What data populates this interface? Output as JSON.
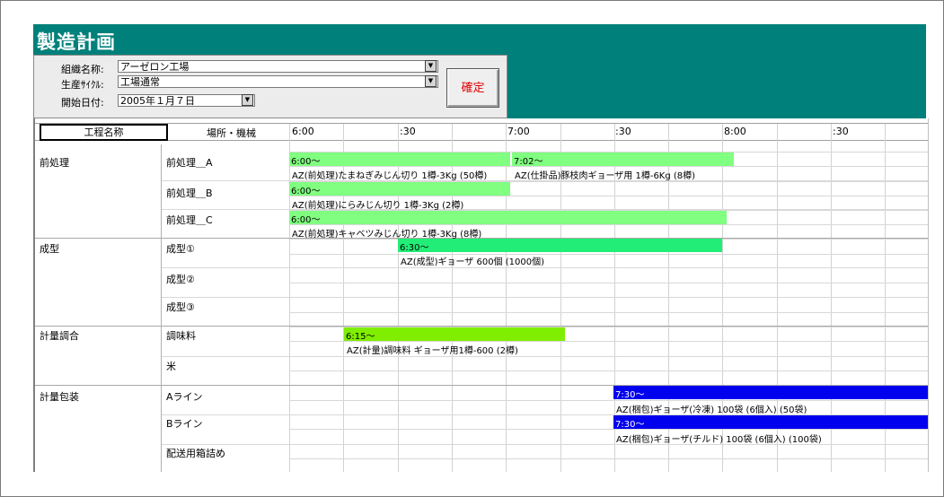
{
  "title": "製造計画",
  "form": {
    "org_label": "組織名称:",
    "org_value": "アーゼロン工場",
    "cycle_label": "生産ｻｲｸﾙ:",
    "cycle_value": "工場通常",
    "date_label": "開始日付:",
    "date_value": "2005年１月７日",
    "confirm_label": "確定"
  },
  "grid": {
    "col_process": "工程名称",
    "col_machine": "場所・機械",
    "time_labels": [
      "6:00",
      ":30",
      "7:00",
      ":30",
      "8:00",
      ":30"
    ],
    "processes": [
      "前処理",
      "成型",
      "計量調合",
      "計量包装"
    ],
    "machines": [
      "前処理＿A",
      "前処理＿B",
      "前処理＿C",
      "成型①",
      "成型②",
      "成型③",
      "調味料",
      "米",
      "Aライン",
      "Bライン",
      "配送用箱詰め"
    ],
    "tasks": [
      {
        "start": "6:00〜",
        "desc": "AZ(前処理)たまねぎみじん切り 1樽-3Kg (50樽)",
        "color": "#80ff80"
      },
      {
        "start": "7:02〜",
        "desc": "AZ(仕掛品)豚枝肉ギョーザ用 1樽-6Kg (8樽)",
        "color": "#80ff80"
      },
      {
        "start": "6:00〜",
        "desc": "AZ(前処理)にらみじん切り 1樽-3Kg (2樽)",
        "color": "#80ff80"
      },
      {
        "start": "6:00〜",
        "desc": "AZ(前処理)キャベツみじん切り 1樽-3Kg (8樽)",
        "color": "#80ff80"
      },
      {
        "start": "6:30〜",
        "desc": "AZ(成型)ギョーザ  600個 (1000個)",
        "color": "#22ee77"
      },
      {
        "start": "6:15〜",
        "desc": "AZ(計量)調味料 ギョーザ用1樽-600 (2樽)",
        "color": "#80ee00"
      },
      {
        "start": "7:30〜",
        "desc": "AZ(梱包)ギョーザ(冷凍) 100袋 (6個入) (50袋)",
        "color": "#0000ee"
      },
      {
        "start": "7:30〜",
        "desc": "AZ(梱包)ギョーザ(チルド) 100袋 (6個入) (100袋)",
        "color": "#0000ee"
      }
    ]
  }
}
